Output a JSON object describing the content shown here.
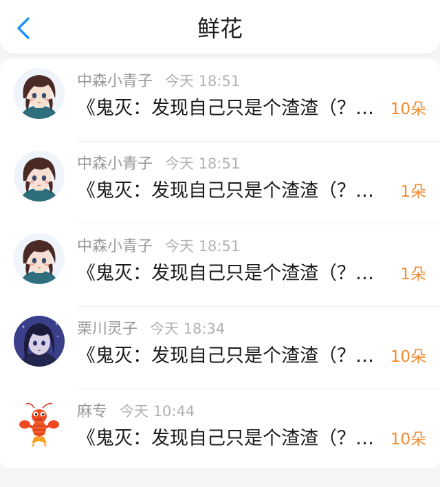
{
  "header": {
    "title": "鲜花"
  },
  "colors": {
    "accent_blue": "#1890ff",
    "count_orange": "#f08c33"
  },
  "items": [
    {
      "username": "中森小青子",
      "time": "今天 18:51",
      "message": "《鬼灭：发现自己只是个渣渣（？…",
      "count": "10朵",
      "avatar_icon": "anime-girl-avatar"
    },
    {
      "username": "中森小青子",
      "time": "今天 18:51",
      "message": "《鬼灭：发现自己只是个渣渣（？…",
      "count": "1朵",
      "avatar_icon": "anime-girl-avatar"
    },
    {
      "username": "中森小青子",
      "time": "今天 18:51",
      "message": "《鬼灭：发现自己只是个渣渣（？…",
      "count": "1朵",
      "avatar_icon": "anime-girl-avatar"
    },
    {
      "username": "栗川灵子",
      "time": "今天 18:34",
      "message": "《鬼灭：发现自己只是个渣渣（？…",
      "count": "10朵",
      "avatar_icon": "anime-girl-night-avatar"
    },
    {
      "username": "麻专",
      "time": "今天 10:44",
      "message": "《鬼灭：发现自己只是个渣渣（？…",
      "count": "10朵",
      "avatar_icon": "crayfish-avatar"
    }
  ]
}
